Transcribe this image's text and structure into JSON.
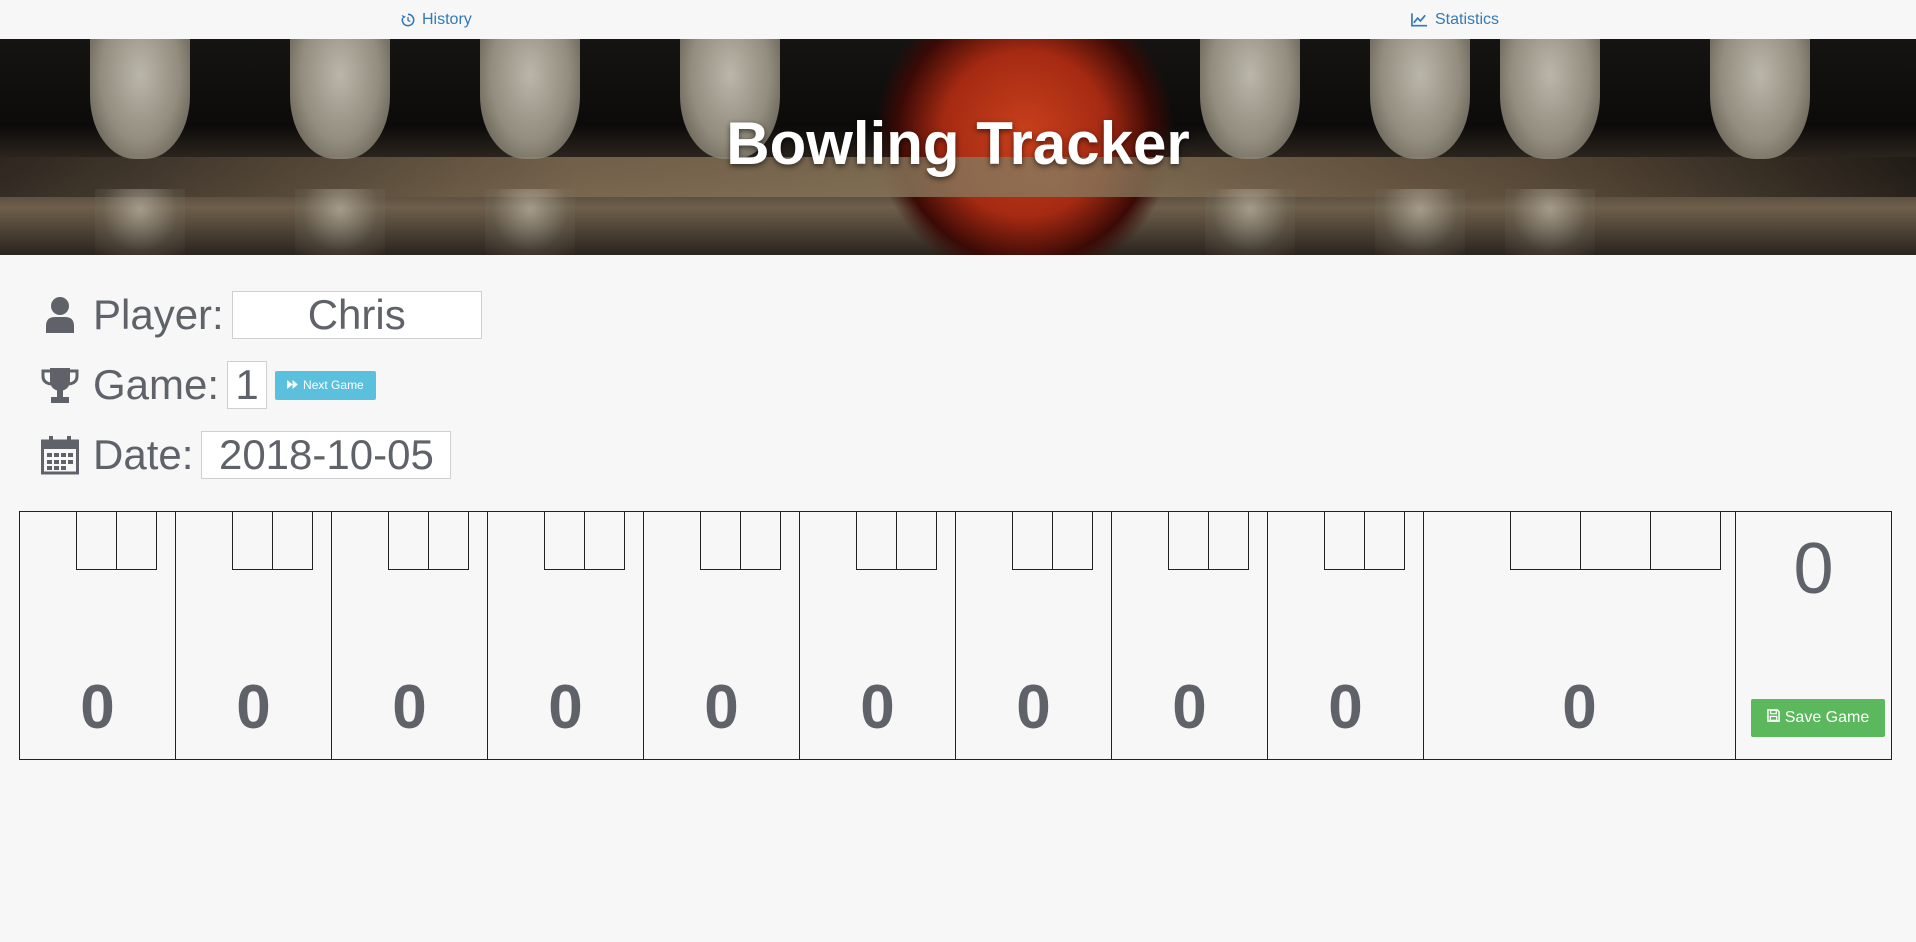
{
  "nav": {
    "history": {
      "label": "History",
      "icon": "history-icon"
    },
    "statistics": {
      "label": "Statistics",
      "icon": "line-chart-icon"
    }
  },
  "hero": {
    "title": "Bowling Tracker"
  },
  "form": {
    "player": {
      "label": "Player:",
      "value": "Chris",
      "icon": "user-icon"
    },
    "game": {
      "label": "Game:",
      "value": "1",
      "icon": "trophy-icon",
      "next_label": "Next Game",
      "next_icon": "fast-forward-icon"
    },
    "date": {
      "label": "Date:",
      "value": "2018-10-05",
      "icon": "calendar-icon"
    }
  },
  "scorecard": {
    "frames": [
      {
        "score": "0"
      },
      {
        "score": "0"
      },
      {
        "score": "0"
      },
      {
        "score": "0"
      },
      {
        "score": "0"
      },
      {
        "score": "0"
      },
      {
        "score": "0"
      },
      {
        "score": "0"
      },
      {
        "score": "0"
      },
      {
        "score": "0"
      }
    ],
    "total": "0",
    "save_label": "Save Game",
    "save_icon": "floppy-disk-icon"
  },
  "colors": {
    "link": "#337ab7",
    "info_button": "#5bc0de",
    "success_button": "#5cb85c",
    "text_gray": "#5f6369"
  }
}
